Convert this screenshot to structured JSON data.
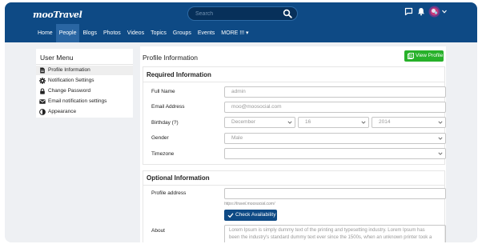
{
  "header": {
    "logo": "mooTravel",
    "search_placeholder": "Search",
    "nav": [
      "Home",
      "People",
      "Blogs",
      "Photos",
      "Videos",
      "Topics",
      "Groups",
      "Events",
      "MORE !!! ▾"
    ],
    "active_nav": "People"
  },
  "sidebar": {
    "title": "User Menu",
    "items": [
      {
        "label": "Profile Information",
        "icon": "profile-doc-icon"
      },
      {
        "label": "Notification Settings",
        "icon": "gear-icon"
      },
      {
        "label": "Change Password",
        "icon": "lock-icon"
      },
      {
        "label": "Email notification settings",
        "icon": "envelope-icon"
      },
      {
        "label": "Appearance",
        "icon": "contrast-icon"
      }
    ]
  },
  "main": {
    "title": "Profile Information",
    "view_profile_label": "View Profile",
    "required": {
      "title": "Required Information",
      "full_name_label": "Full Name",
      "full_name_value": "admin",
      "email_label": "Email Address",
      "email_value": "moo@moosocial.com",
      "birthday_label": "Birthday",
      "birthday_help": "(?)",
      "birthday_month": "December",
      "birthday_day": "16",
      "birthday_year": "2014",
      "gender_label": "Gender",
      "gender_value": "Male",
      "timezone_label": "Timezone",
      "timezone_value": ""
    },
    "optional": {
      "title": "Optional Information",
      "profile_address_label": "Profile address",
      "profile_address_value": "",
      "profile_address_hint": "https://travel.moosocial.com/",
      "check_availability_label": "Check Availability",
      "about_label": "About",
      "about_lines": [
        "Lorem Ipsum is simply dummy text of the printing and typesetting industry. Lorem Ipsum has",
        "been the industry's standard dummy text ever since the 1500s, when an unknown printer took a"
      ]
    }
  }
}
